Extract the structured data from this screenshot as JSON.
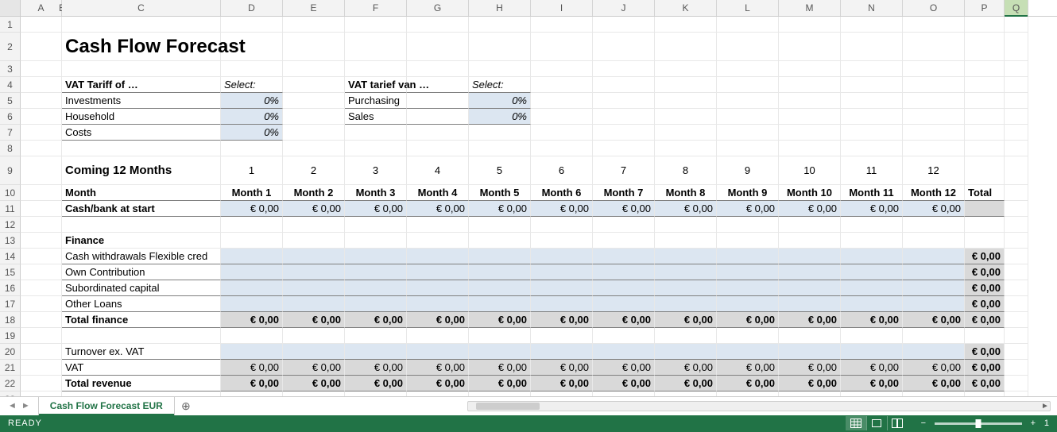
{
  "columns": [
    "A",
    "B",
    "C",
    "D",
    "E",
    "F",
    "G",
    "H",
    "I",
    "J",
    "K",
    "L",
    "M",
    "N",
    "O",
    "P",
    "Q"
  ],
  "selected_column": "Q",
  "title": "Cash Flow Forecast",
  "vat_left": {
    "header": "VAT Tariff of …",
    "select_label": "Select:",
    "rows": [
      {
        "label": "Investments",
        "value": "0%"
      },
      {
        "label": "Household",
        "value": "0%"
      },
      {
        "label": "Costs",
        "value": "0%"
      }
    ]
  },
  "vat_right": {
    "header": "VAT tarief van …",
    "select_label": "Select:",
    "rows": [
      {
        "label": "Purchasing",
        "value": "0%"
      },
      {
        "label": "Sales",
        "value": "0%"
      }
    ]
  },
  "section_head": "Coming 12 Months",
  "month_numbers": [
    "1",
    "2",
    "3",
    "4",
    "5",
    "6",
    "7",
    "8",
    "9",
    "10",
    "11",
    "12"
  ],
  "month_row_label": "Month",
  "month_labels": [
    "Month 1",
    "Month 2",
    "Month 3",
    "Month 4",
    "Month 5",
    "Month 6",
    "Month 7",
    "Month 8",
    "Month 9",
    "Month 10",
    "Month 11",
    "Month 12"
  ],
  "total_label": "Total",
  "zero": "€ 0,00",
  "cash_start_label": "Cash/bank at start",
  "finance": {
    "header": "Finance",
    "rows": [
      "Cash withdrawals Flexible cred",
      "Own Contribution",
      "Subordinated capital",
      "Other Loans"
    ],
    "total_label": "Total finance"
  },
  "revenue": {
    "rows": [
      {
        "label": "Turnover ex. VAT",
        "months": false
      },
      {
        "label": "VAT",
        "months": true
      }
    ],
    "total_label": "Total revenue"
  },
  "sheet_tab": "Cash Flow Forecast EUR",
  "status": {
    "ready": "READY",
    "zoom": "1"
  }
}
